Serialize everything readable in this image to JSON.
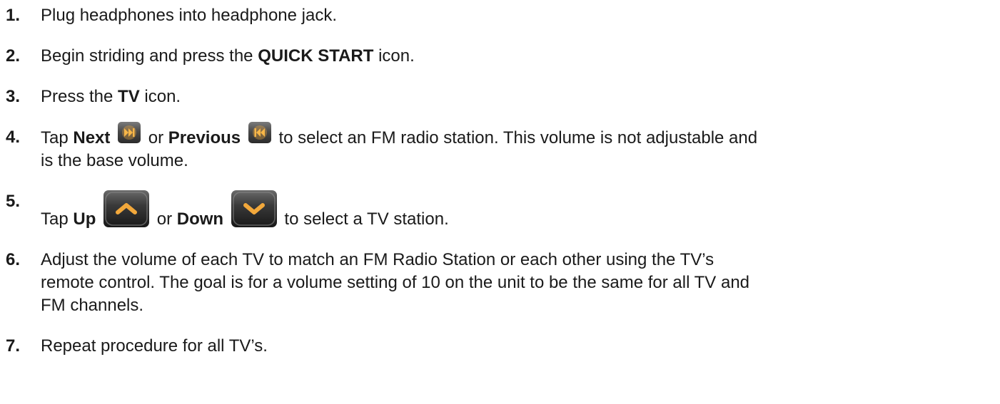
{
  "steps": [
    {
      "number": "1.",
      "text": "Plug headphones into headphone jack."
    },
    {
      "number": "2.",
      "pre": "Begin striding and press the ",
      "bold": "QUICK START",
      "post": " icon."
    },
    {
      "number": "3.",
      "pre": "Press the ",
      "bold": "TV",
      "post": " icon."
    },
    {
      "number": "4.",
      "pre": "Tap ",
      "bold1": "Next",
      "mid": " or ",
      "bold2": "Previous",
      "post_line1": " to select an FM radio station. This volume is not adjustable and",
      "post_line2": "is the base volume."
    },
    {
      "number": "5.",
      "pre": "Tap ",
      "bold1": "Up",
      "mid": " or ",
      "bold2": "Down",
      "post": " to select a TV station."
    },
    {
      "number": "6.",
      "line1": "Adjust the volume of each TV to match an FM Radio Station or each other using the TV’s",
      "line2": "remote control. The goal is for a volume setting of 10 on the unit to be the same for all TV and",
      "line3": "FM channels."
    },
    {
      "number": "7.",
      "text": "Repeat procedure for all TV’s."
    }
  ],
  "icons": {
    "next": "next-track-icon",
    "previous": "previous-track-icon",
    "up": "up-chevron-icon",
    "down": "down-chevron-icon",
    "accent_color": "#f2a83b"
  }
}
